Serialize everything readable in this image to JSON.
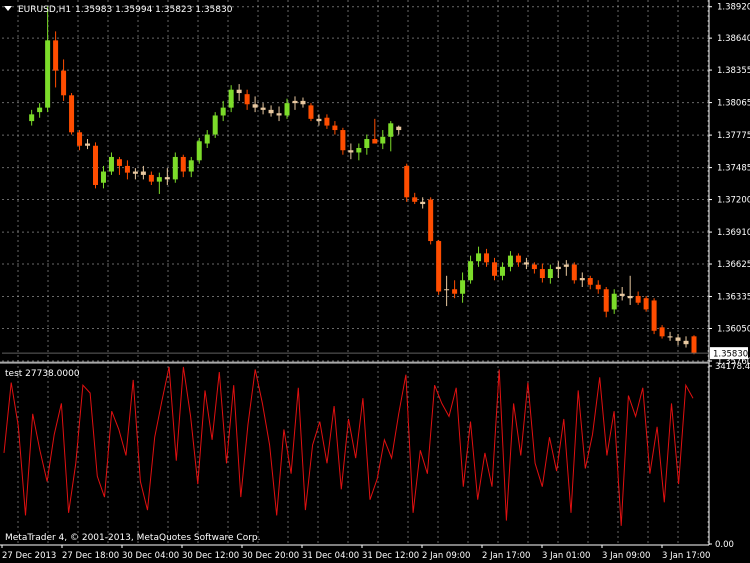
{
  "window": {
    "symbol_label": "EURUSD,H1",
    "ohlc_label": "1.35983 1.35994 1.35823 1.35830",
    "copyright": "MetaTrader 4, © 2001-2013, MetaQuotes Software Corp.",
    "colors": {
      "background": "#000000",
      "grid": "#b0b0b0",
      "axis_text": "#ffffff",
      "bull": "#7cdc2a",
      "bear": "#ff4d00",
      "doji": "#e8c8a0",
      "indicator": "#e01010",
      "current_price_box": "#ffffff"
    }
  },
  "chart_data": [
    {
      "type": "candlestick",
      "title": "EURUSD,H1",
      "ohlc_header": "1.35983 1.35994 1.35823 1.35830",
      "ylim": [
        1.3576,
        1.3898
      ],
      "y_ticks": [
        "1.38920",
        "1.38640",
        "1.38355",
        "1.38065",
        "1.37775",
        "1.37485",
        "1.37200",
        "1.36910",
        "1.36625",
        "1.36335",
        "1.36050",
        "1.35760"
      ],
      "current_price": "1.35830",
      "x_ticks": [
        "27 Dec 2013",
        "27 Dec 18:00",
        "30 Dec 04:00",
        "30 Dec 12:00",
        "30 Dec 20:00",
        "31 Dec 04:00",
        "31 Dec 12:00",
        "2 Jan 09:00",
        "2 Jan 17:00",
        "3 Jan 01:00",
        "3 Jan 09:00",
        "3 Jan 17:00"
      ],
      "candles": [
        {
          "o": 1.379,
          "h": 1.38,
          "l": 1.3786,
          "c": 1.3796
        },
        {
          "o": 1.3798,
          "h": 1.3806,
          "l": 1.3793,
          "c": 1.3802
        },
        {
          "o": 1.3802,
          "h": 1.3892,
          "l": 1.3798,
          "c": 1.3862
        },
        {
          "o": 1.3862,
          "h": 1.387,
          "l": 1.382,
          "c": 1.3835
        },
        {
          "o": 1.3835,
          "h": 1.3845,
          "l": 1.3808,
          "c": 1.3813
        },
        {
          "o": 1.3813,
          "h": 1.3815,
          "l": 1.3778,
          "c": 1.378
        },
        {
          "o": 1.378,
          "h": 1.3782,
          "l": 1.3764,
          "c": 1.3768
        },
        {
          "o": 1.377,
          "h": 1.3774,
          "l": 1.3765,
          "c": 1.3768
        },
        {
          "o": 1.3768,
          "h": 1.3771,
          "l": 1.373,
          "c": 1.3733
        },
        {
          "o": 1.3735,
          "h": 1.375,
          "l": 1.373,
          "c": 1.3745
        },
        {
          "o": 1.3745,
          "h": 1.3762,
          "l": 1.3742,
          "c": 1.3758
        },
        {
          "o": 1.3756,
          "h": 1.3758,
          "l": 1.3742,
          "c": 1.375
        },
        {
          "o": 1.375,
          "h": 1.3755,
          "l": 1.3738,
          "c": 1.3744
        },
        {
          "o": 1.3743,
          "h": 1.3748,
          "l": 1.3738,
          "c": 1.3745
        },
        {
          "o": 1.3745,
          "h": 1.375,
          "l": 1.3738,
          "c": 1.3742
        },
        {
          "o": 1.3742,
          "h": 1.3745,
          "l": 1.3733,
          "c": 1.3736
        },
        {
          "o": 1.3736,
          "h": 1.3744,
          "l": 1.3725,
          "c": 1.374
        },
        {
          "o": 1.374,
          "h": 1.3748,
          "l": 1.3733,
          "c": 1.3738
        },
        {
          "o": 1.3738,
          "h": 1.3762,
          "l": 1.3735,
          "c": 1.3758
        },
        {
          "o": 1.3758,
          "h": 1.376,
          "l": 1.374,
          "c": 1.3745
        },
        {
          "o": 1.3745,
          "h": 1.3758,
          "l": 1.374,
          "c": 1.3755
        },
        {
          "o": 1.3755,
          "h": 1.3775,
          "l": 1.3752,
          "c": 1.3772
        },
        {
          "o": 1.377,
          "h": 1.3782,
          "l": 1.3766,
          "c": 1.3778
        },
        {
          "o": 1.3778,
          "h": 1.3798,
          "l": 1.3775,
          "c": 1.3795
        },
        {
          "o": 1.3795,
          "h": 1.3808,
          "l": 1.379,
          "c": 1.3802
        },
        {
          "o": 1.3802,
          "h": 1.3822,
          "l": 1.3798,
          "c": 1.3818
        },
        {
          "o": 1.3818,
          "h": 1.3823,
          "l": 1.3808,
          "c": 1.3815
        },
        {
          "o": 1.3814,
          "h": 1.3818,
          "l": 1.38,
          "c": 1.3805
        },
        {
          "o": 1.3805,
          "h": 1.3812,
          "l": 1.3798,
          "c": 1.3802
        },
        {
          "o": 1.3802,
          "h": 1.3806,
          "l": 1.3796,
          "c": 1.38
        },
        {
          "o": 1.38,
          "h": 1.3804,
          "l": 1.3794,
          "c": 1.3797
        },
        {
          "o": 1.3797,
          "h": 1.3803,
          "l": 1.379,
          "c": 1.3795
        },
        {
          "o": 1.3795,
          "h": 1.381,
          "l": 1.3792,
          "c": 1.3806
        },
        {
          "o": 1.3806,
          "h": 1.3812,
          "l": 1.38,
          "c": 1.3808
        },
        {
          "o": 1.3808,
          "h": 1.3811,
          "l": 1.3802,
          "c": 1.3805
        },
        {
          "o": 1.3804,
          "h": 1.3806,
          "l": 1.379,
          "c": 1.3792
        },
        {
          "o": 1.3792,
          "h": 1.3796,
          "l": 1.3786,
          "c": 1.379
        },
        {
          "o": 1.3793,
          "h": 1.3796,
          "l": 1.3783,
          "c": 1.3786
        },
        {
          "o": 1.3786,
          "h": 1.379,
          "l": 1.3778,
          "c": 1.3782
        },
        {
          "o": 1.3782,
          "h": 1.3784,
          "l": 1.376,
          "c": 1.3764
        },
        {
          "o": 1.3764,
          "h": 1.377,
          "l": 1.3756,
          "c": 1.3762
        },
        {
          "o": 1.3762,
          "h": 1.377,
          "l": 1.3755,
          "c": 1.3766
        },
        {
          "o": 1.3766,
          "h": 1.3778,
          "l": 1.376,
          "c": 1.3774
        },
        {
          "o": 1.3774,
          "h": 1.3792,
          "l": 1.377,
          "c": 1.377
        },
        {
          "o": 1.377,
          "h": 1.3782,
          "l": 1.3765,
          "c": 1.3776
        },
        {
          "o": 1.3776,
          "h": 1.379,
          "l": 1.3763,
          "c": 1.3788
        },
        {
          "o": 1.3785,
          "h": 1.3786,
          "l": 1.3778,
          "c": 1.3782
        },
        {
          "o": 1.375,
          "h": 1.3752,
          "l": 1.3718,
          "c": 1.3722
        },
        {
          "o": 1.3722,
          "h": 1.3726,
          "l": 1.3716,
          "c": 1.3718
        },
        {
          "o": 1.3718,
          "h": 1.3722,
          "l": 1.3712,
          "c": 1.3716
        },
        {
          "o": 1.372,
          "h": 1.3722,
          "l": 1.368,
          "c": 1.3683
        },
        {
          "o": 1.3683,
          "h": 1.3684,
          "l": 1.3635,
          "c": 1.3638
        },
        {
          "o": 1.364,
          "h": 1.3652,
          "l": 1.3625,
          "c": 1.364
        },
        {
          "o": 1.364,
          "h": 1.3648,
          "l": 1.3632,
          "c": 1.3636
        },
        {
          "o": 1.3636,
          "h": 1.3655,
          "l": 1.3628,
          "c": 1.3648
        },
        {
          "o": 1.3648,
          "h": 1.367,
          "l": 1.3645,
          "c": 1.3665
        },
        {
          "o": 1.3665,
          "h": 1.3678,
          "l": 1.366,
          "c": 1.3672
        },
        {
          "o": 1.3672,
          "h": 1.3676,
          "l": 1.366,
          "c": 1.3664
        },
        {
          "o": 1.3664,
          "h": 1.3668,
          "l": 1.3648,
          "c": 1.3652
        },
        {
          "o": 1.3652,
          "h": 1.3664,
          "l": 1.3648,
          "c": 1.366
        },
        {
          "o": 1.366,
          "h": 1.3674,
          "l": 1.3656,
          "c": 1.367
        },
        {
          "o": 1.367,
          "h": 1.3672,
          "l": 1.366,
          "c": 1.3664
        },
        {
          "o": 1.3664,
          "h": 1.3668,
          "l": 1.3658,
          "c": 1.3662
        },
        {
          "o": 1.3662,
          "h": 1.3664,
          "l": 1.3654,
          "c": 1.3658
        },
        {
          "o": 1.3658,
          "h": 1.3663,
          "l": 1.3646,
          "c": 1.365
        },
        {
          "o": 1.365,
          "h": 1.3662,
          "l": 1.3645,
          "c": 1.3658
        },
        {
          "o": 1.3658,
          "h": 1.3665,
          "l": 1.365,
          "c": 1.366
        },
        {
          "o": 1.366,
          "h": 1.3666,
          "l": 1.3652,
          "c": 1.3662
        },
        {
          "o": 1.3662,
          "h": 1.3664,
          "l": 1.3645,
          "c": 1.3648
        },
        {
          "o": 1.3648,
          "h": 1.3655,
          "l": 1.3642,
          "c": 1.365
        },
        {
          "o": 1.365,
          "h": 1.3652,
          "l": 1.364,
          "c": 1.3644
        },
        {
          "o": 1.3644,
          "h": 1.3648,
          "l": 1.3636,
          "c": 1.364
        },
        {
          "o": 1.364,
          "h": 1.3642,
          "l": 1.3615,
          "c": 1.362
        },
        {
          "o": 1.3622,
          "h": 1.364,
          "l": 1.3618,
          "c": 1.3636
        },
        {
          "o": 1.3636,
          "h": 1.3642,
          "l": 1.363,
          "c": 1.3634
        },
        {
          "o": 1.3634,
          "h": 1.3652,
          "l": 1.3626,
          "c": 1.3632
        },
        {
          "o": 1.3634,
          "h": 1.3638,
          "l": 1.3626,
          "c": 1.3628
        },
        {
          "o": 1.3632,
          "h": 1.3634,
          "l": 1.362,
          "c": 1.3622
        },
        {
          "o": 1.363,
          "h": 1.3632,
          "l": 1.36,
          "c": 1.3603
        },
        {
          "o": 1.3606,
          "h": 1.3608,
          "l": 1.3596,
          "c": 1.3598
        },
        {
          "o": 1.3598,
          "h": 1.3602,
          "l": 1.3594,
          "c": 1.3597
        },
        {
          "o": 1.3597,
          "h": 1.36,
          "l": 1.359,
          "c": 1.3594
        },
        {
          "o": 1.3594,
          "h": 1.3598,
          "l": 1.3588,
          "c": 1.3591
        },
        {
          "o": 1.3598,
          "h": 1.3599,
          "l": 1.3582,
          "c": 1.3583
        }
      ]
    },
    {
      "type": "line",
      "title": "test 27738.0000",
      "ylim": [
        0,
        34178.45
      ],
      "y_ticks": [
        "34178.45",
        "0.00"
      ],
      "series": [
        {
          "color": "#e01010",
          "values": [
            17500,
            31000,
            22500,
            5500,
            25000,
            18000,
            12000,
            21000,
            27000,
            6000,
            15500,
            30500,
            29000,
            13000,
            9000,
            25500,
            22000,
            17000,
            31500,
            12000,
            6500,
            20500,
            27500,
            34000,
            16000,
            34000,
            24500,
            11500,
            29500,
            20000,
            33000,
            15500,
            30500,
            9000,
            23000,
            33500,
            27000,
            19000,
            5500,
            22000,
            13500,
            30000,
            6500,
            19000,
            23500,
            15500,
            26500,
            10500,
            24000,
            16500,
            28000,
            8500,
            12500,
            20000,
            16500,
            25000,
            32500,
            6000,
            18000,
            13500,
            30500,
            27000,
            24500,
            30000,
            11000,
            23500,
            8500,
            17500,
            11000,
            33500,
            4500,
            27000,
            17000,
            31000,
            15500,
            11000,
            20500,
            14000,
            24000,
            6000,
            29500,
            14500,
            21000,
            32000,
            17000,
            25500,
            3500,
            28500,
            24500,
            30000,
            13500,
            22500,
            8000,
            27000,
            11500,
            30500,
            28000
          ]
        }
      ]
    }
  ]
}
